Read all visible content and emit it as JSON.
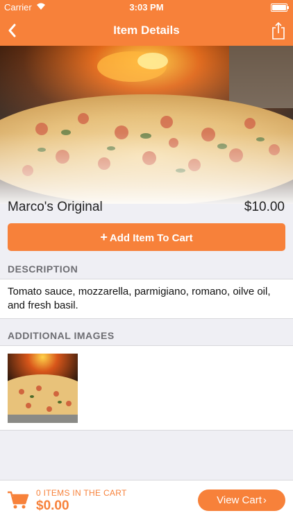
{
  "status_bar": {
    "carrier": "Carrier",
    "time": "3:03 PM"
  },
  "nav": {
    "title": "Item Details",
    "back_icon": "chevron-left-icon",
    "share_icon": "share-icon"
  },
  "item": {
    "name": "Marco's Original",
    "price": "$10.00"
  },
  "add_button": {
    "icon": "+",
    "label": "Add Item To Cart"
  },
  "description": {
    "header": "DESCRIPTION",
    "text": "Tomato sauce, mozzarella, parmigiano, romano, oilve oil, and fresh basil."
  },
  "additional_images": {
    "header": "ADDITIONAL IMAGES",
    "count": 1
  },
  "footer": {
    "cart_count_text": "0 ITEMS IN THE CART",
    "cart_total": "$0.00",
    "view_cart_label": "View Cart",
    "view_cart_chevron": "›"
  },
  "colors": {
    "accent": "#f7813a",
    "background": "#efeff4",
    "text": "#111111",
    "section_header_text": "#6d6d72"
  }
}
